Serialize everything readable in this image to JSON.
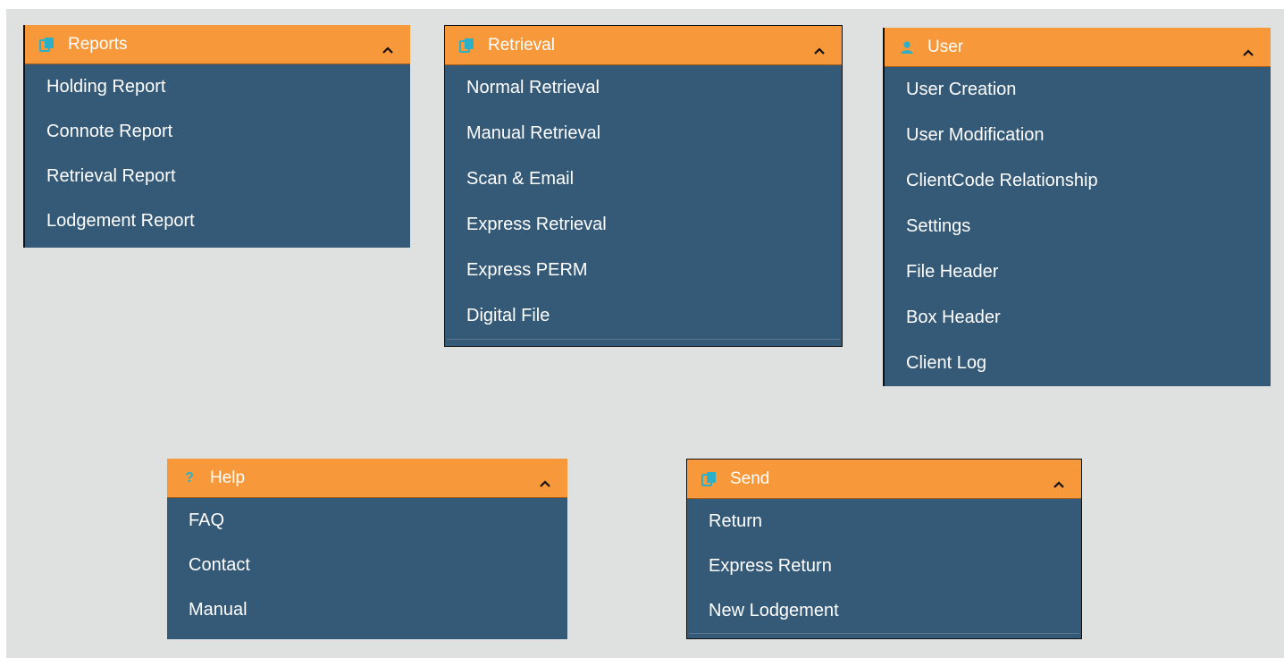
{
  "menus": {
    "reports": {
      "title": "Reports",
      "icon": "copy-icon",
      "items": [
        "Holding Report",
        "Connote Report",
        "Retrieval Report",
        "Lodgement Report"
      ]
    },
    "retrieval": {
      "title": "Retrieval",
      "icon": "copy-icon",
      "items": [
        "Normal Retrieval",
        "Manual Retrieval",
        "Scan & Email",
        "Express Retrieval",
        "Express PERM",
        "Digital File"
      ]
    },
    "user": {
      "title": "User",
      "icon": "user-icon",
      "items": [
        "User Creation",
        "User Modification",
        "ClientCode Relationship",
        "Settings",
        "File Header",
        "Box Header",
        "Client Log"
      ]
    },
    "help": {
      "title": "Help",
      "icon": "question-icon",
      "items": [
        "FAQ",
        "Contact",
        "Manual"
      ]
    },
    "send": {
      "title": "Send",
      "icon": "copy-icon",
      "items": [
        "Return",
        "Express Return",
        "New Lodgement"
      ]
    }
  },
  "colors": {
    "header": "#f7993b",
    "panel": "#355a77",
    "background": "#dfe1e0",
    "icon": "#2ab0c9"
  }
}
